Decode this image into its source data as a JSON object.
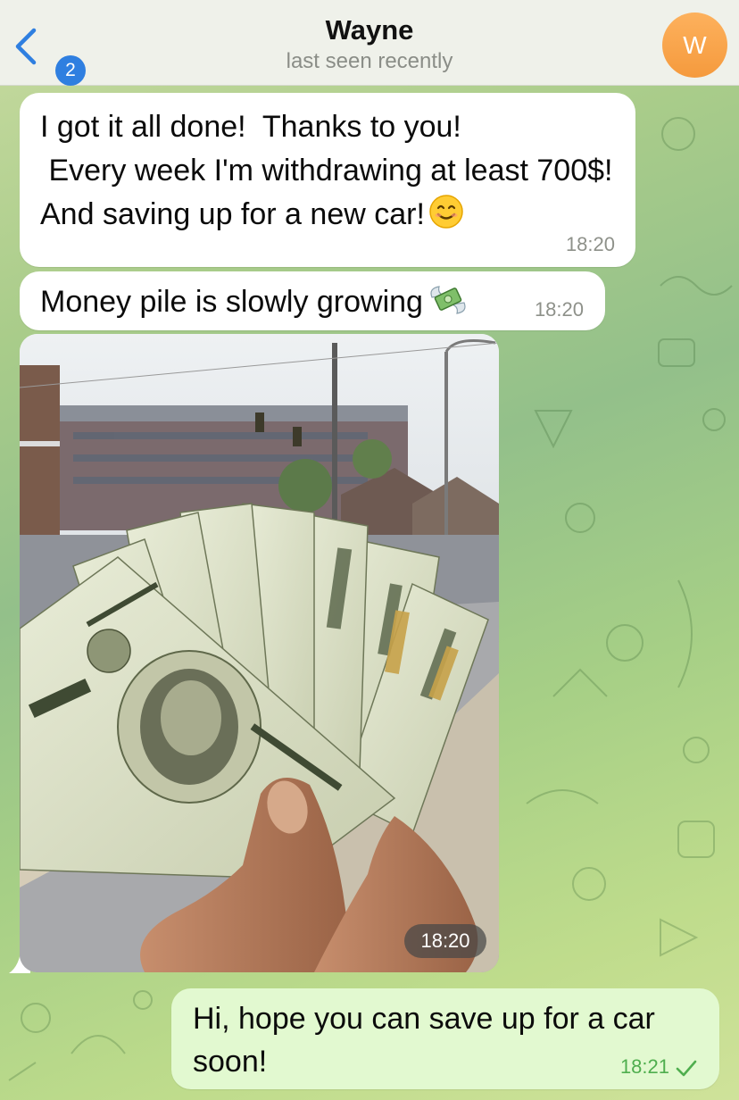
{
  "header": {
    "back_count": "2",
    "contact_name": "Wayne",
    "status": "last seen recently",
    "avatar_initial": "W",
    "avatar_color": "#f7a64a",
    "accent": "#2f7fe0"
  },
  "messages": [
    {
      "direction": "incoming",
      "text": "I got it all done!  Thanks to you!\n Every week I'm withdrawing at least 700$!  And saving up for a new car!",
      "emoji": "smiling-face-emoji",
      "time": "18:20"
    },
    {
      "direction": "incoming",
      "text": "Money pile is slowly growing",
      "emoji": "money-with-wings-emoji",
      "time": "18:20"
    },
    {
      "direction": "incoming",
      "type": "photo",
      "content": "hand holding fanned $100 bills on a street",
      "time": "18:20"
    },
    {
      "direction": "outgoing",
      "text": "Hi, hope you can save up for a car soon!",
      "time": "18:21",
      "status_icon": "read-check-icon",
      "bubble_color": "#e2f9d0"
    }
  ]
}
